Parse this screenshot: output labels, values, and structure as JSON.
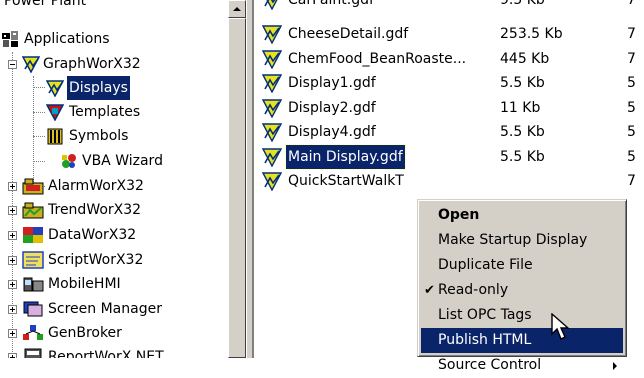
{
  "tree": {
    "root_label": "Power Plant",
    "applications_label": "Applications",
    "graphworx_label": "GraphWorX32",
    "children": [
      "Displays",
      "Templates",
      "Symbols",
      "VBA Wizard"
    ],
    "siblings": [
      "AlarmWorX32",
      "TrendWorX32",
      "DataWorX32",
      "ScriptWorX32",
      "MobileHMI",
      "Screen Manager",
      "GenBroker",
      "ReportWorX.NET"
    ]
  },
  "files": {
    "partial_top": {
      "name": "CarPaint.gdf",
      "size": "9.5 Kb",
      "extra": "7"
    },
    "rows": [
      {
        "name": "CheeseDetail.gdf",
        "size": "253.5 Kb",
        "extra": "7"
      },
      {
        "name": "ChemFood_BeanRoaste...",
        "size": "445 Kb",
        "extra": "7"
      },
      {
        "name": "Display1.gdf",
        "size": "5.5 Kb",
        "extra": "5"
      },
      {
        "name": "Display2.gdf",
        "size": "11 Kb",
        "extra": "5"
      },
      {
        "name": "Display4.gdf",
        "size": "5.5 Kb",
        "extra": "5"
      },
      {
        "name": "Main Display.gdf",
        "size": "5.5 Kb",
        "extra": "5"
      },
      {
        "name": "QuickStartWalkT",
        "size": "",
        "extra": "7"
      }
    ]
  },
  "context_menu": {
    "items": [
      "Open",
      "Make Startup Display",
      "Duplicate File",
      "Read-only",
      "List OPC Tags",
      "Publish HTML",
      "Source Control"
    ],
    "checkmark": "✔"
  },
  "colors": {
    "selection": "#0a246a",
    "menu_bg": "#d4d0c8"
  }
}
